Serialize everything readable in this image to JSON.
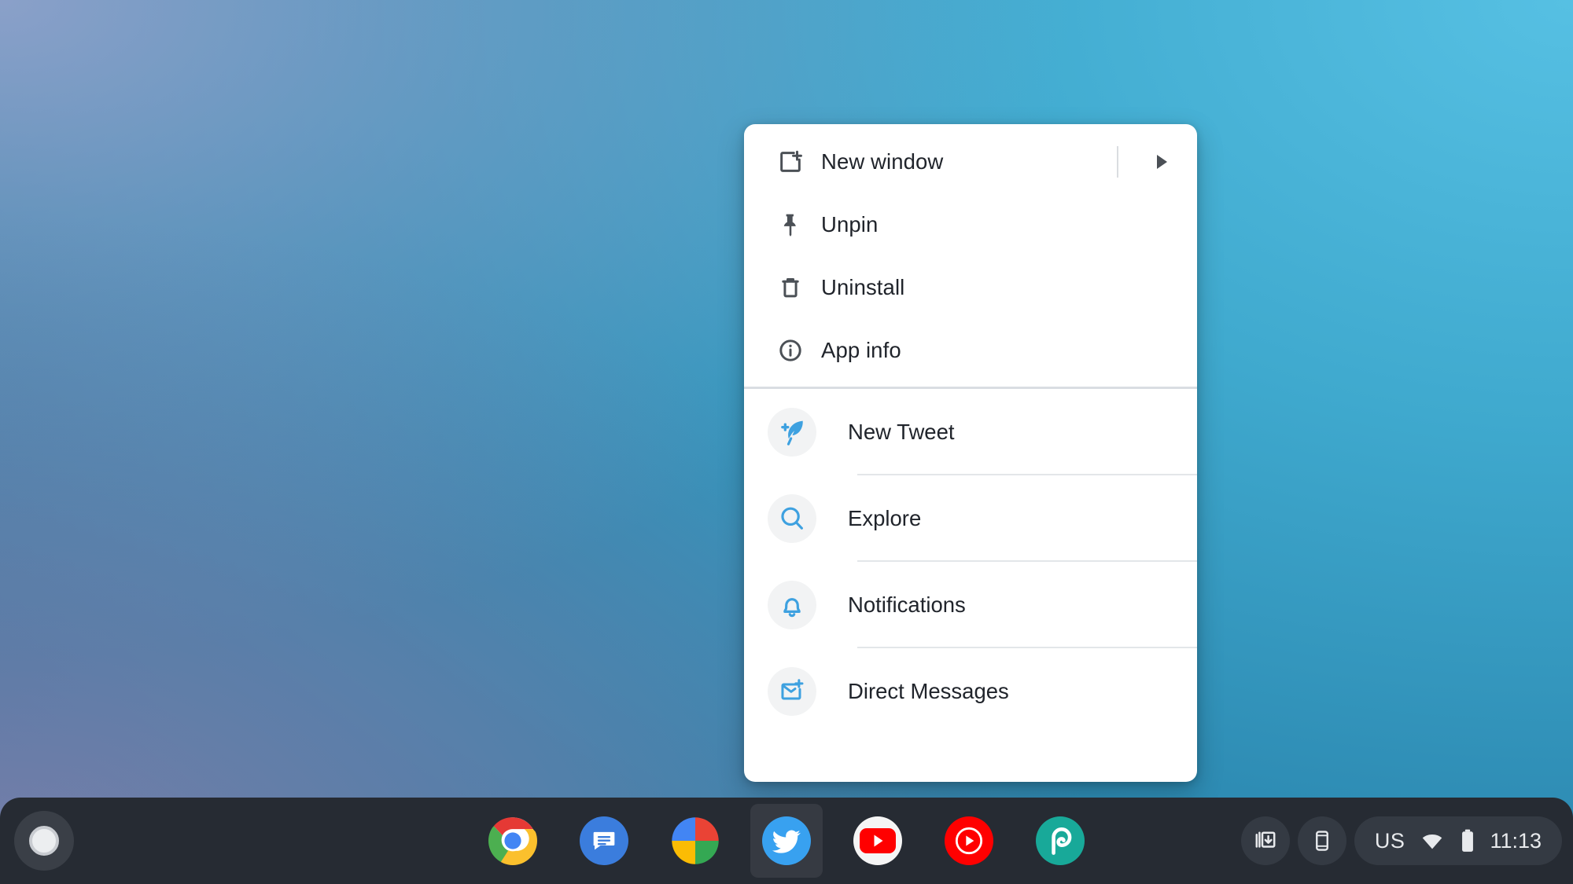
{
  "desktop": {
    "wallpaper_colors": {
      "top_left": "#93a3cc",
      "top_right": "#56c0e3",
      "bottom_left": "#7e80ac",
      "bottom_right": "#1f6e96"
    }
  },
  "context_menu": {
    "system_items": [
      {
        "label": "New window",
        "icon": "new-window-icon",
        "has_submenu": true
      },
      {
        "label": "Unpin",
        "icon": "pin-icon",
        "has_submenu": false
      },
      {
        "label": "Uninstall",
        "icon": "trash-icon",
        "has_submenu": false
      },
      {
        "label": "App info",
        "icon": "info-icon",
        "has_submenu": false
      }
    ],
    "app_shortcuts": [
      {
        "label": "New Tweet",
        "icon": "quill-plus-icon"
      },
      {
        "label": "Explore",
        "icon": "search-icon"
      },
      {
        "label": "Notifications",
        "icon": "bell-icon"
      },
      {
        "label": "Direct Messages",
        "icon": "envelope-plus-icon"
      }
    ],
    "accent_color": "#3ea1e0",
    "text_color": "#20242b"
  },
  "shelf": {
    "launcher": {
      "name": "launcher-button"
    },
    "apps": [
      {
        "name": "Chrome",
        "icon": "chrome-icon",
        "active": false
      },
      {
        "name": "Messages",
        "icon": "messages-icon",
        "active": false
      },
      {
        "name": "Play Store",
        "icon": "play-store-icon",
        "active": false
      },
      {
        "name": "Twitter",
        "icon": "twitter-icon",
        "active": true
      },
      {
        "name": "YouTube",
        "icon": "youtube-icon",
        "active": false
      },
      {
        "name": "YouTube Music",
        "icon": "youtube-music-icon",
        "active": false
      },
      {
        "name": "Photopea",
        "icon": "photopea-icon",
        "active": false
      }
    ],
    "tray": {
      "capture_icon": "screen-capture-icon",
      "phone_icon": "phone-hub-icon",
      "ime_label": "US",
      "wifi_icon": "wifi-icon",
      "battery_icon": "battery-icon",
      "clock": "11:13"
    },
    "background_color": "#262b33"
  }
}
